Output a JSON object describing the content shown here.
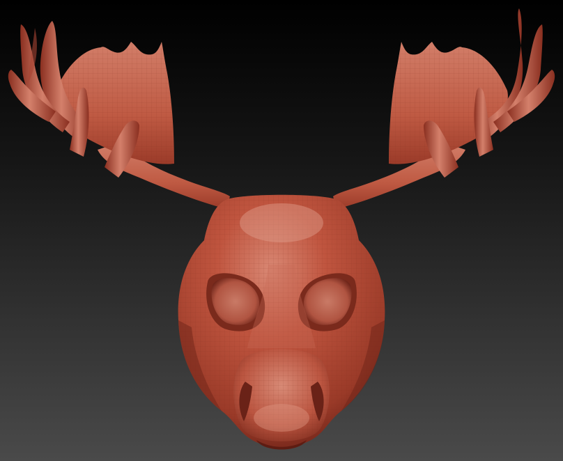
{
  "scene": {
    "subject": "moose-head-sculpt",
    "colors": {
      "background_top": "#000000",
      "background_bottom": "#4a4a4a",
      "clay_base": "#b34a35",
      "clay_light": "#d98874",
      "clay_mid": "#c0553f",
      "clay_dark": "#6e2318",
      "wire_line": "#7a2a1c"
    }
  }
}
